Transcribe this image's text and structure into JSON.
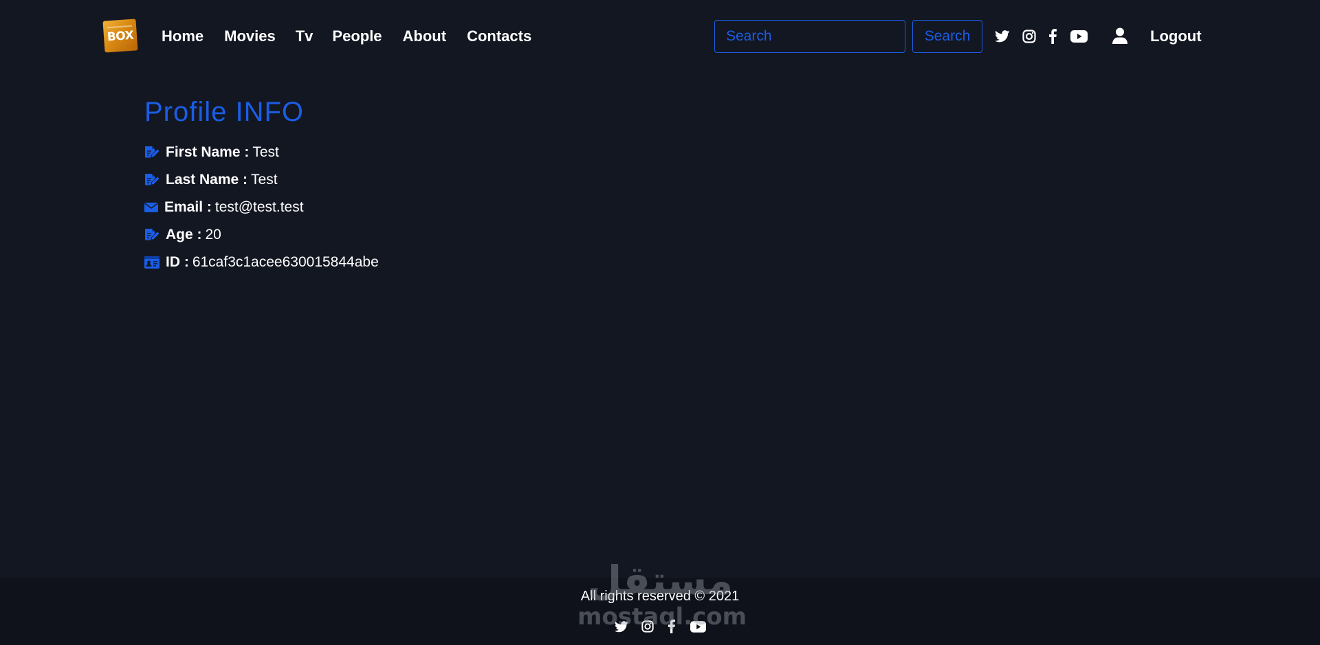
{
  "navbar": {
    "logo_text": "BOX",
    "links": [
      {
        "label": "Home"
      },
      {
        "label": "Movies"
      },
      {
        "label": "Tv"
      },
      {
        "label": "People"
      },
      {
        "label": "About"
      },
      {
        "label": "Contacts"
      }
    ],
    "search": {
      "placeholder": "Search",
      "value": "",
      "button_label": "Search"
    },
    "social_icons": [
      "twitter-icon",
      "instagram-icon",
      "facebook-icon",
      "youtube-icon"
    ],
    "user_icon": "user-icon",
    "logout_label": "Logout"
  },
  "profile": {
    "title": "Profile INFO",
    "fields": [
      {
        "icon": "edit-icon",
        "label": "First Name :",
        "value": "Test"
      },
      {
        "icon": "edit-icon",
        "label": "Last Name :",
        "value": "Test"
      },
      {
        "icon": "envelope-icon",
        "label": "Email :",
        "value": "test@test.test"
      },
      {
        "icon": "edit-icon",
        "label": "Age :",
        "value": "20"
      },
      {
        "icon": "id-card-icon",
        "label": "ID :",
        "value": "61caf3c1acee630015844abe"
      }
    ]
  },
  "footer": {
    "copyright": "All rights reserved © 2021",
    "social_icons": [
      "twitter-icon",
      "instagram-icon",
      "facebook-icon",
      "youtube-icon"
    ]
  },
  "watermark": {
    "arabic": "مستقل",
    "latin": "mostaql.com"
  },
  "colors": {
    "background": "#131722",
    "footer_background": "#0f121a",
    "accent": "#1b5de5",
    "text": "#ffffff"
  }
}
